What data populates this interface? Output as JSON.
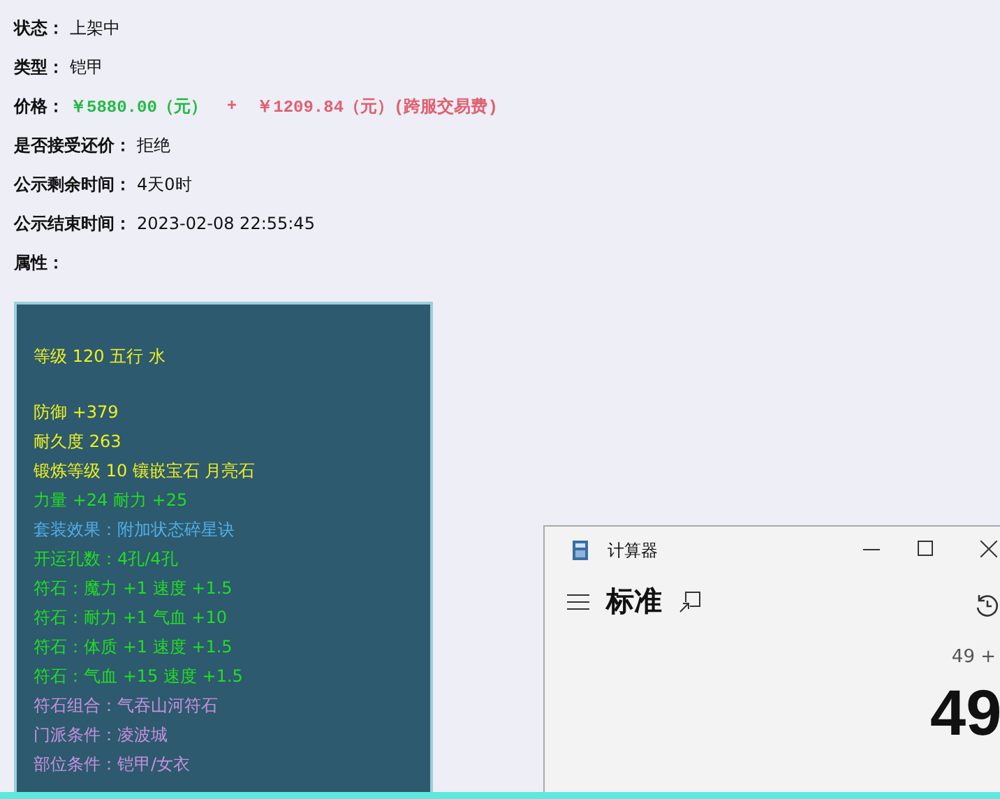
{
  "fields": [
    {
      "label": "状态：",
      "value": "上架中"
    },
    {
      "label": "类型：",
      "value": "铠甲"
    },
    {
      "label": "价格：",
      "parts": [
        {
          "text": "￥5880.00（元）",
          "color": "#22bb44"
        },
        {
          "text": "+",
          "color": "#e06070"
        },
        {
          "text": "￥1209.84（元）(跨服交易费)",
          "color": "#e06070"
        }
      ]
    },
    {
      "label": "是否接受还价：",
      "value": "拒绝"
    },
    {
      "label": "公示剩余时间：",
      "value": "4天0时"
    },
    {
      "label": "公示结束时间：",
      "value": "2023-02-08 22:55:45"
    },
    {
      "label": "属性："
    }
  ],
  "attributes": {
    "groups": [
      [
        {
          "text": "等级 120 五行 水",
          "color": "#f0f020"
        }
      ],
      [
        {
          "text": "防御 +379",
          "color": "#f0f020"
        },
        {
          "text": "耐久度 263",
          "color": "#f0f020"
        },
        {
          "text": "锻炼等级 10 镶嵌宝石 月亮石",
          "color": "#f0f020"
        },
        {
          "text": "力量 +24 耐力 +25",
          "color": "#22dd22"
        },
        {
          "text": "套装效果：附加状态碎星诀",
          "color": "#50aee8"
        },
        {
          "text": "开运孔数：4孔/4孔",
          "color": "#22dd22"
        },
        {
          "text": "符石：魔力 +1 速度 +1.5",
          "color": "#22dd22"
        },
        {
          "text": "符石：耐力 +1 气血 +10",
          "color": "#22dd22"
        },
        {
          "text": "符石：体质 +1 速度 +1.5",
          "color": "#22dd22"
        },
        {
          "text": "符石：气血 +15 速度 +1.5",
          "color": "#22dd22"
        },
        {
          "text": "符石组合：气吞山河符石",
          "color": "#c890e0"
        },
        {
          "text": "门派条件：凌波城",
          "color": "#c890e0"
        },
        {
          "text": "部位条件：铠甲/女衣",
          "color": "#c890e0"
        }
      ]
    ]
  },
  "calculator": {
    "title": "计算器",
    "mode": "标准",
    "expression": "49 +",
    "result": "49"
  }
}
